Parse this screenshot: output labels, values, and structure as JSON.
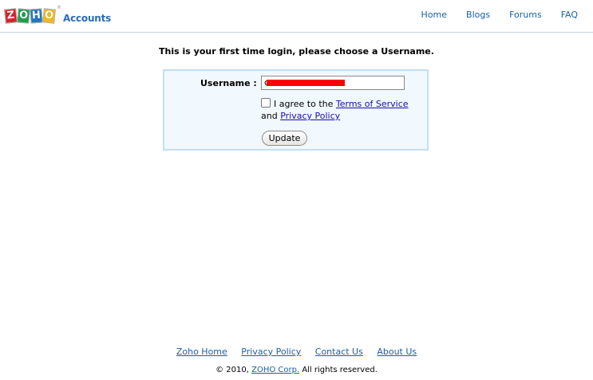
{
  "header": {
    "logo_letters": [
      "Z",
      "O",
      "H",
      "O"
    ],
    "logo_reg": "®",
    "logo_product": "Accounts",
    "nav": [
      "Home",
      "Blogs",
      "Forums",
      "FAQ"
    ]
  },
  "prompt": "This is your first time login, please choose a Username.",
  "form": {
    "username_label": "Username :",
    "username_value": "c",
    "agree_prefix": "I agree to the",
    "terms_link": "Terms of Service",
    "and_text": "and",
    "privacy_link": "Privacy Policy",
    "update_label": "Update",
    "redaction_color": "#ff0000"
  },
  "footer": {
    "links": [
      "Zoho Home",
      "Privacy Policy",
      "Contact Us",
      "About Us"
    ],
    "copyright_prefix": "© 2010,",
    "company_link": "ZOHO Corp.",
    "copyright_suffix": "All rights reserved."
  },
  "colors": {
    "link": "#1a5fa6",
    "form_border": "#c4def0",
    "form_bg": "#f1f8fe"
  }
}
